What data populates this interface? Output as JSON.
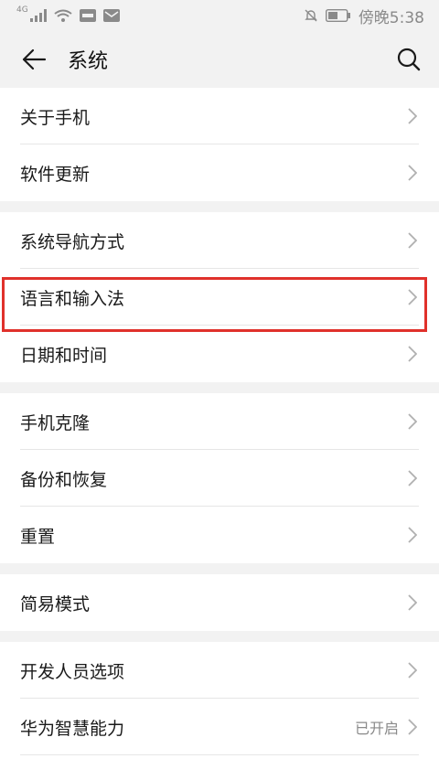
{
  "status_bar": {
    "network": "4G",
    "time": "傍晚5:38"
  },
  "app_bar": {
    "title": "系统",
    "back_icon": "arrow-left-icon",
    "search_icon": "search-icon"
  },
  "groups": [
    {
      "items": [
        {
          "label": "关于手机"
        },
        {
          "label": "软件更新"
        }
      ]
    },
    {
      "items": [
        {
          "label": "系统导航方式"
        },
        {
          "label": "语言和输入法"
        },
        {
          "label": "日期和时间"
        }
      ]
    },
    {
      "items": [
        {
          "label": "手机克隆"
        },
        {
          "label": "备份和恢复"
        },
        {
          "label": "重置"
        }
      ]
    },
    {
      "items": [
        {
          "label": "简易模式"
        }
      ]
    },
    {
      "items": [
        {
          "label": "开发人员选项"
        },
        {
          "label": "华为智慧能力",
          "value": "已开启"
        }
      ]
    }
  ],
  "highlight_color": "#e0312b"
}
